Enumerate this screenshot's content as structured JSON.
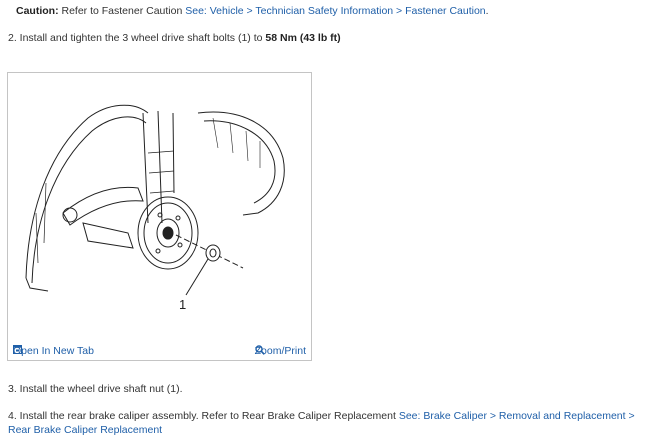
{
  "caution": {
    "label": "Caution:",
    "text": " Refer to Fastener Caution ",
    "link": "See: Vehicle > Technician Safety Information > Fastener Caution",
    "tail": "."
  },
  "step2": {
    "text": "2. Install and tighten the 3 wheel drive shaft bolts (1) to ",
    "torque": "58 Nm (43 lb ft)"
  },
  "figure": {
    "callout": "1",
    "open_tab": "Open In New Tab",
    "zoom_print": "Zoom/Print",
    "icons": {
      "open_tab": "open-tab-icon",
      "zoom": "magnifier-icon"
    }
  },
  "step3": {
    "text": "3. Install the wheel drive shaft nut (1)."
  },
  "step4": {
    "text": "4. Install the rear brake caliper assembly. Refer to Rear Brake Caliper Replacement ",
    "link": "See: Brake Caliper > Removal and Replacement > Rear Brake Caliper Replacement"
  },
  "colors": {
    "link": "#1f5fa8",
    "text": "#333333",
    "border": "#c4c4c4"
  }
}
